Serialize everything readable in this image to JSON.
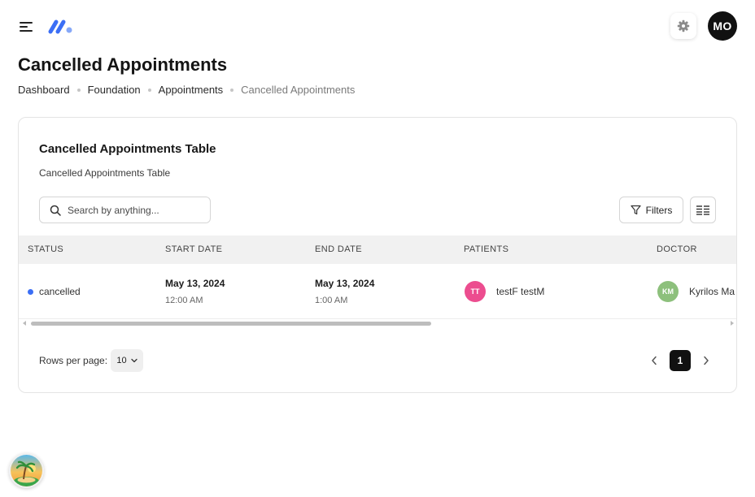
{
  "header": {
    "user_initials": "MO",
    "icons": {
      "menu": "hamburger-menu-icon",
      "logo": "brand-logo-icon",
      "settings": "gear-icon"
    }
  },
  "page": {
    "title": "Cancelled Appointments",
    "breadcrumb": [
      "Dashboard",
      "Foundation",
      "Appointments",
      "Cancelled Appointments"
    ]
  },
  "card": {
    "title": "Cancelled Appointments Table",
    "subtitle": "Cancelled Appointments Table",
    "search_placeholder": "Search by anything...",
    "filters_label": "Filters",
    "columns": [
      "STATUS",
      "START DATE",
      "END DATE",
      "PATIENTS",
      "DOCTOR"
    ],
    "rows": [
      {
        "status": "cancelled",
        "start_date": "May 13, 2024",
        "start_time": "12:00 AM",
        "end_date": "May 13, 2024",
        "end_time": "1:00 AM",
        "patient_initials": "TT",
        "patient_name": "testF testM",
        "doctor_initials": "KM",
        "doctor_name": "Kyrilos Ma"
      }
    ],
    "pagination": {
      "rows_per_page_label": "Rows per page:",
      "rows_per_page": "10",
      "current_page": "1"
    }
  },
  "colors": {
    "status_cancelled": "#3b6ef5",
    "patient_avatar": "#ec4d8f",
    "doctor_avatar": "#8dc07c",
    "brand_logo": "#3b6ef5",
    "dark": "#111111"
  }
}
